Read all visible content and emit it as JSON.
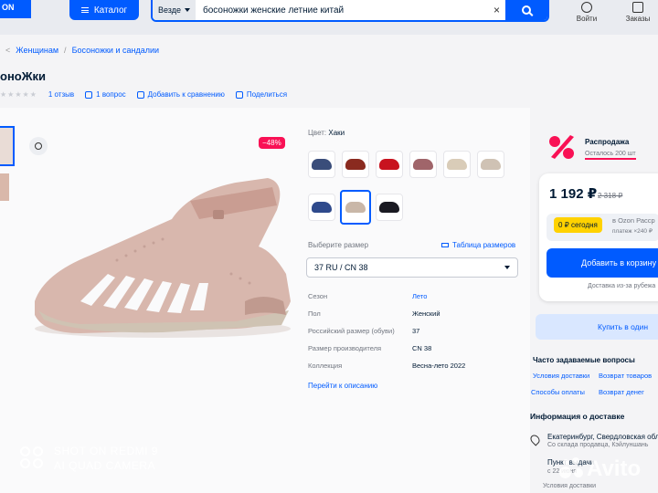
{
  "header": {
    "logo_text": "ON",
    "catalog_label": "Каталог",
    "search_scope": "Везде",
    "search_value": "босоножки женские летние китай",
    "clear_icon": "×",
    "login_label": "Войти",
    "orders_label": "Заказы"
  },
  "breadcrumbs": [
    "Женщинам",
    "Босоножки и сандалии"
  ],
  "product": {
    "title": "оноЖки",
    "stars": "★★★★★",
    "reviews": "1 отзыв",
    "questions": "1 вопрос",
    "compare": "Добавить к сравнению",
    "share": "Поделиться",
    "discount": "−48%",
    "color_label": "Цвет:",
    "color_value": "Хаки",
    "size_label": "Выберите размер",
    "size_table": "Таблица размеров",
    "size_selected": "37 RU / CN 38",
    "specs": [
      {
        "k": "Сезон",
        "v": "Лето",
        "link": true
      },
      {
        "k": "Пол",
        "v": "Женский",
        "link": false
      },
      {
        "k": "Российский размер (обуви)",
        "v": "37",
        "link": false
      },
      {
        "k": "Размер производителя",
        "v": "CN 38",
        "link": false
      },
      {
        "k": "Коллекция",
        "v": "Весна-лето 2022",
        "link": false
      }
    ],
    "to_description": "Перейти к описанию"
  },
  "sale": {
    "title": "Распродажа",
    "left": "Осталось 200 шт",
    "price": "1 192 ₽",
    "old_price": "2 318 ₽",
    "today": "0 ₽ сегодня",
    "installment": "в Ozon Расср",
    "installment_sub": "платеж ×240 ₽",
    "add_to_cart": "Добавить в корзину",
    "delivery_note": "Доставка из-за рубежа",
    "one_click": "Купить в один"
  },
  "faq": {
    "title": "Часто задаваемые вопросы",
    "links": [
      "Условия доставки",
      "Возврат товаров",
      "Способы оплаты",
      "Возврат денег"
    ]
  },
  "delivery": {
    "title": "Информация о доставке",
    "city": "Екатеринбург, Свердловская обл",
    "city_sub": "Со склада продавца, Кэйлуншань",
    "pickup": "Пункт выдачи",
    "pickup_sub": "с 22 июня",
    "conditions": "Условия доставки"
  },
  "watermark": {
    "line1": "SHOT ON REDMI 9",
    "line2": "AI QUAD CAMERA",
    "avito": "Avito"
  },
  "colors": {
    "accent": "#005bff",
    "discount": "#f91155",
    "badge": "#ffd200"
  }
}
